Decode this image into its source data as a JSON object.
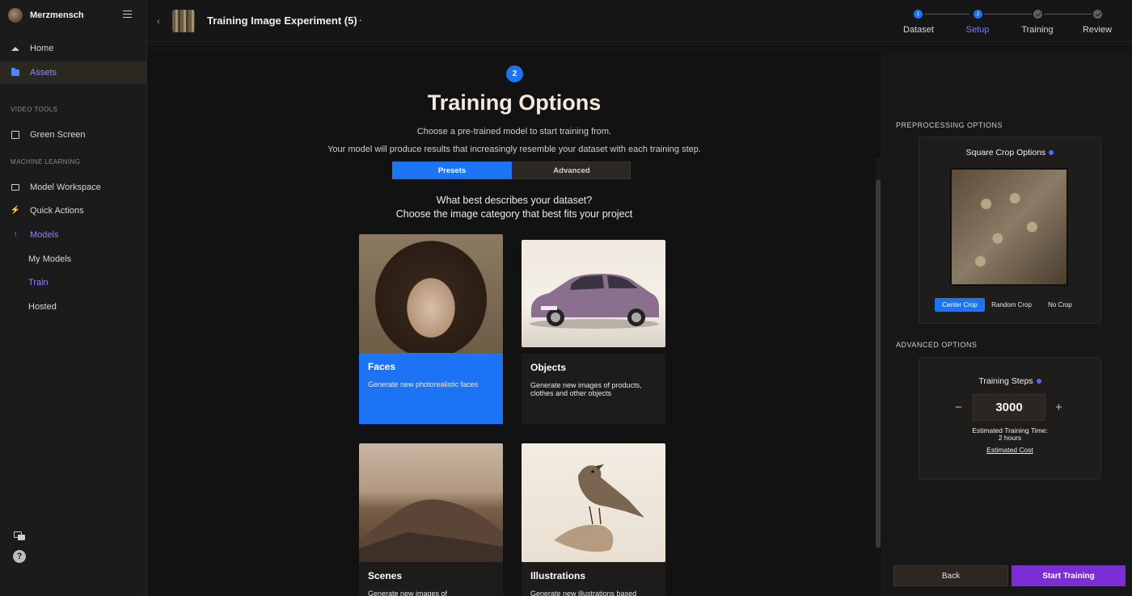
{
  "brand": {
    "name": "Merzmensch"
  },
  "sidebar": {
    "items": [
      {
        "label": "Home"
      },
      {
        "label": "Assets"
      }
    ],
    "section_video": "VIDEO TOOLS",
    "video_items": [
      {
        "label": "Green Screen"
      }
    ],
    "section_ml": "MACHINE LEARNING",
    "ml_items": [
      {
        "label": "Model Workspace"
      },
      {
        "label": "Quick Actions"
      },
      {
        "label": "Models"
      },
      {
        "label": "My Models"
      },
      {
        "label": "Train"
      },
      {
        "label": "Hosted"
      }
    ]
  },
  "topbar": {
    "project_title": "Training Image Experiment (5)",
    "more_label": "···"
  },
  "stepper": {
    "steps": [
      {
        "label": "Dataset",
        "badge": "1"
      },
      {
        "label": "Setup",
        "badge": "2"
      },
      {
        "label": "Training"
      },
      {
        "label": "Review"
      }
    ]
  },
  "main": {
    "step_number": "2",
    "title": "Training Options",
    "subtitle_1": "Choose a pre-trained model to start training from.",
    "subtitle_2": "Your model will produce results that increasingly resemble your dataset with each training step.",
    "tabs": [
      {
        "label": "Presets"
      },
      {
        "label": "Advanced"
      }
    ],
    "question_1": "What best describes your dataset?",
    "question_2": "Choose the image category that best fits your project",
    "cards": [
      {
        "title": "Faces",
        "desc": "Generate new photorealistic faces"
      },
      {
        "title": "Objects",
        "desc": "Generate new images of products, clothes and other objects"
      },
      {
        "title": "Scenes",
        "desc": "Generate new images of"
      },
      {
        "title": "Illustrations",
        "desc": "Generate new illustrations based"
      }
    ]
  },
  "right_panel": {
    "preprocessing_label": "PREPROCESSING OPTIONS",
    "crop_title": "Square Crop Options",
    "crop_options": [
      {
        "label": "Center Crop"
      },
      {
        "label": "Random Crop"
      },
      {
        "label": "No Crop"
      }
    ],
    "advanced_label": "ADVANCED OPTIONS",
    "steps_title": "Training Steps",
    "steps_value": "3000",
    "minus": "−",
    "plus": "+",
    "est_time_label": "Estimated Training Time:",
    "est_time_value": "2 hours",
    "est_cost": "Estimated Cost",
    "back": "Back",
    "start": "Start Training"
  },
  "colors": {
    "accent_blue": "#1c74f4",
    "accent_purple": "#7b2ed4",
    "active_nav_text": "#8c8cff"
  }
}
